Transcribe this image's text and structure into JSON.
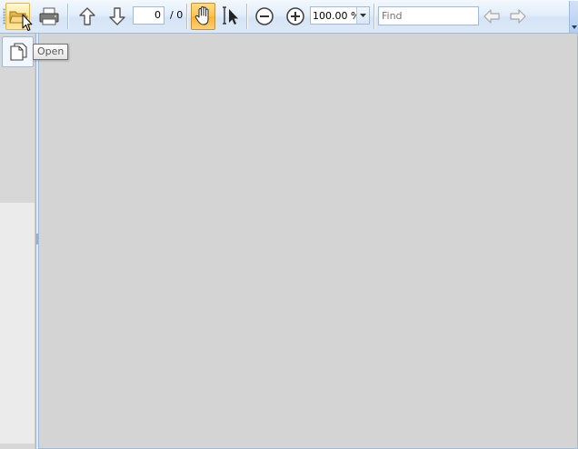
{
  "toolbar": {
    "open": {
      "icon": "folder-open-icon",
      "state": "hover"
    },
    "print": {
      "icon": "printer-icon"
    },
    "previous_page": {
      "icon": "arrow-up-icon"
    },
    "next_page": {
      "icon": "arrow-down-icon"
    },
    "page_number": "0",
    "page_total": "/ 0",
    "pan_tool": {
      "icon": "hand-icon",
      "state": "pressed"
    },
    "select_tool": {
      "icon": "text-select-cursor-icon"
    },
    "zoom_out": {
      "icon": "minus-circle-icon"
    },
    "zoom_in": {
      "icon": "plus-circle-icon"
    },
    "zoom_value": "100.00 %",
    "find_placeholder": "Find",
    "find_previous": {
      "icon": "arrow-left-icon"
    },
    "find_next": {
      "icon": "arrow-right-icon"
    }
  },
  "side_panel": {
    "open_button": {
      "icon": "document-pages-icon"
    }
  },
  "tooltip": {
    "text": "Open"
  },
  "colors": {
    "toolbar_border": "#9ebbe0",
    "viewer_background": "#d4d4d4",
    "hover_highlight": "#ffe69a",
    "pressed_highlight": "#ffc44c"
  }
}
